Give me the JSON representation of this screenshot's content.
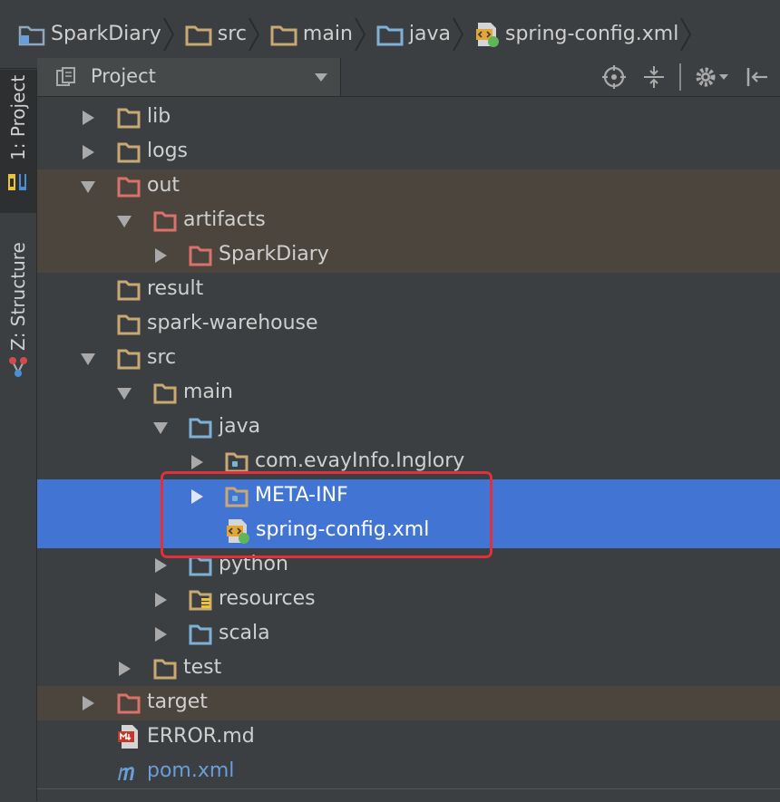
{
  "breadcrumb": [
    {
      "label": "SparkDiary",
      "icon": "module-icon"
    },
    {
      "label": "src",
      "icon": "folder-icon"
    },
    {
      "label": "main",
      "icon": "folder-icon"
    },
    {
      "label": "java",
      "icon": "source-folder-icon"
    },
    {
      "label": "spring-config.xml",
      "icon": "spring-xml-icon"
    }
  ],
  "tool_tabs": {
    "project": "1: Project",
    "structure": "Z: Structure"
  },
  "panel": {
    "view_label": "Project",
    "actions": [
      "locate-icon",
      "collapse-all-icon",
      "gear-icon",
      "hide-icon"
    ]
  },
  "tree": [
    {
      "label": "lib",
      "icon": "folder-icon",
      "expanded": false
    },
    {
      "label": "logs",
      "icon": "folder-icon",
      "expanded": false
    },
    {
      "label": "out",
      "icon": "excluded-folder-icon",
      "expanded": true
    },
    {
      "label": "artifacts",
      "icon": "excluded-folder-icon",
      "expanded": true
    },
    {
      "label": "SparkDiary",
      "icon": "excluded-folder-icon",
      "expanded": false
    },
    {
      "label": "result",
      "icon": "folder-icon"
    },
    {
      "label": "spark-warehouse",
      "icon": "folder-icon"
    },
    {
      "label": "src",
      "icon": "folder-icon",
      "expanded": true
    },
    {
      "label": "main",
      "icon": "folder-icon",
      "expanded": true
    },
    {
      "label": "java",
      "icon": "source-folder-icon",
      "expanded": true
    },
    {
      "label": "com.evayInfo.Inglory",
      "icon": "package-icon",
      "expanded": false
    },
    {
      "label": "META-INF",
      "icon": "package-icon",
      "expanded": false
    },
    {
      "label": "spring-config.xml",
      "icon": "spring-xml-icon"
    },
    {
      "label": "python",
      "icon": "source-folder-icon",
      "expanded": false
    },
    {
      "label": "resources",
      "icon": "resources-folder-icon",
      "expanded": false
    },
    {
      "label": "scala",
      "icon": "source-folder-icon",
      "expanded": false
    },
    {
      "label": "test",
      "icon": "folder-icon",
      "expanded": false
    },
    {
      "label": "target",
      "icon": "excluded-folder-icon",
      "expanded": false
    },
    {
      "label": "ERROR.md",
      "icon": "markdown-file-icon"
    },
    {
      "label": "pom.xml",
      "icon": "maven-file-icon"
    }
  ],
  "colors": {
    "background": "#3c3f41",
    "selection": "#4275d3",
    "excluded_row": "#4b453d",
    "highlight_box": "#e0303c"
  }
}
